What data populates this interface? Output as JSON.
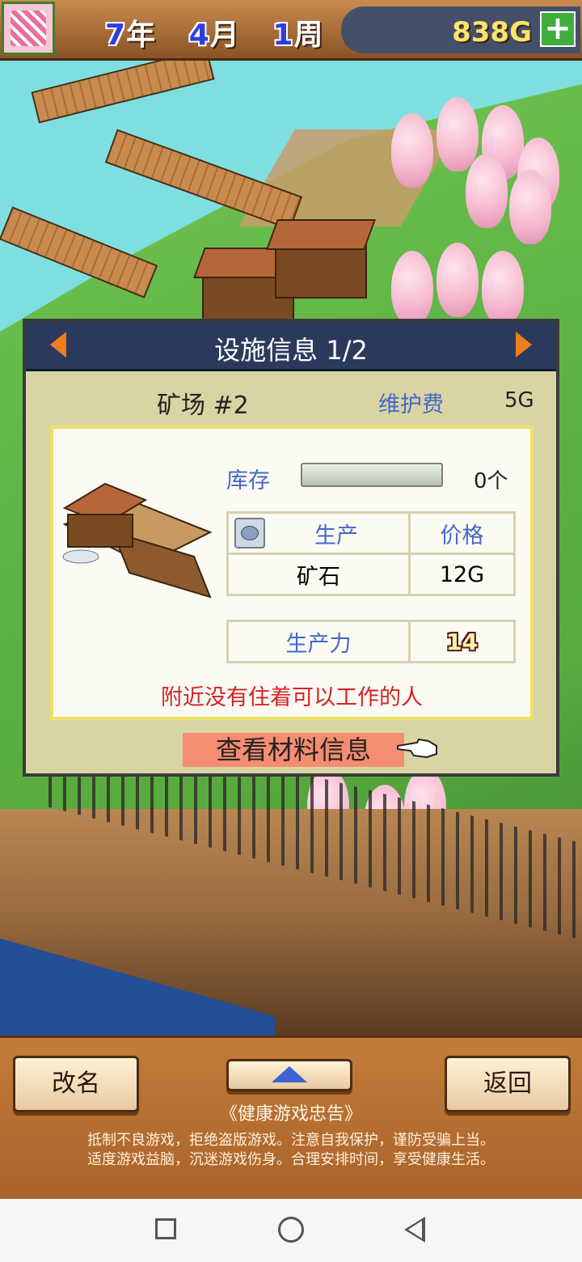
{
  "header": {
    "year": "7",
    "year_unit": "年",
    "month": "4",
    "month_unit": "月",
    "week": "1",
    "week_unit": "周",
    "money": "838G",
    "add_icon": "plus-icon"
  },
  "dialog": {
    "title": "设施信息 1/2",
    "facility_name": "矿场 #2",
    "maintenance_label": "维护费",
    "maintenance_value": "5G",
    "stock_label": "库存",
    "stock_value": "0个",
    "stock_fill": 0,
    "production": {
      "header_produce": "生产",
      "header_price": "价格",
      "item": "矿石",
      "price": "12G"
    },
    "power_label": "生产力",
    "power_value": "14",
    "warning": "附近没有住着可以工作的人",
    "material_button": "查看材料信息"
  },
  "bottom": {
    "rename_label": "改名",
    "back_label": "返回",
    "notice_title": "《健康游戏忠告》",
    "notice_line1": "抵制不良游戏，拒绝盗版游戏。注意自我保护，谨防受骗上当。",
    "notice_line2": "适度游戏益脑，沉迷游戏伤身。合理安排时间，享受健康生活。"
  },
  "colors": {
    "accent_blue": "#4568c7",
    "warning_red": "#d42323",
    "dialog_bg": "#d9d4a4",
    "button_highlight": "#f48d71"
  }
}
